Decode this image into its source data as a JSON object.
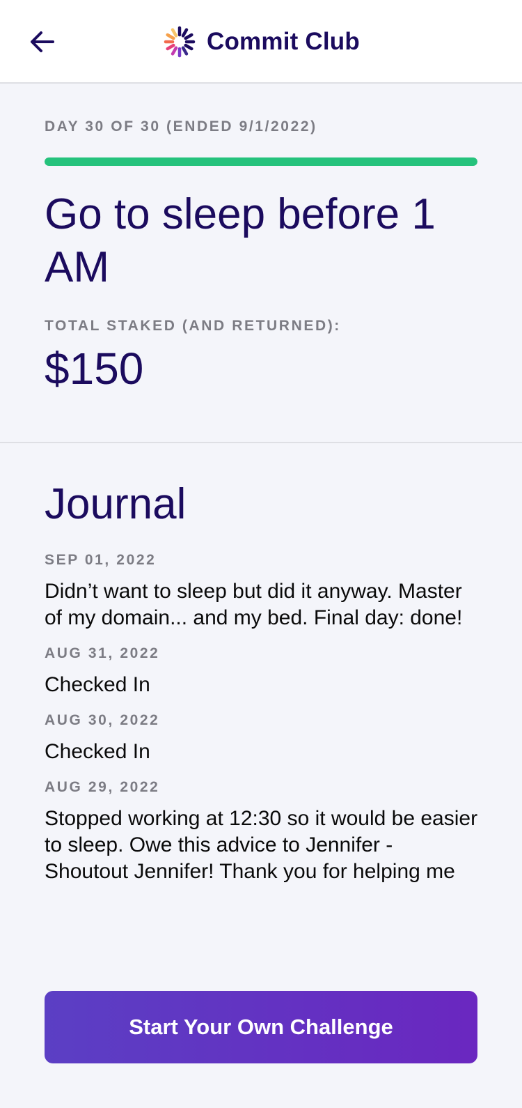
{
  "header": {
    "back_icon": "arrow-left-icon",
    "logo_icon": "commit-club-logo-icon",
    "app_title": "Commit Club",
    "brand_color": "#1b0b5e"
  },
  "challenge": {
    "day_status": "DAY 30 OF 30 (ENDED 9/1/2022)",
    "progress": 1.0,
    "progress_color": "#25c27c",
    "goal": "Go to sleep before 1 AM",
    "stake_label": "TOTAL STAKED (AND RETURNED):",
    "stake_amount": "$150"
  },
  "journal": {
    "title": "Journal",
    "entries": [
      {
        "date": "SEP 01, 2022",
        "text": "Didn’t want to sleep but did it anyway. Master of my domain... and my bed. Final day: done!"
      },
      {
        "date": "AUG 31, 2022",
        "text": "Checked In"
      },
      {
        "date": "AUG 30, 2022",
        "text": "Checked In"
      },
      {
        "date": "AUG 29, 2022",
        "text": "Stopped working at 12:30 so it would be easier to sleep. Owe this advice to Jennifer - Shoutout Jennifer! Thank you for helping me"
      }
    ]
  },
  "cta": {
    "label": "Start Your Own Challenge",
    "gradient": [
      "#5b3fc4",
      "#6a27c0"
    ]
  }
}
